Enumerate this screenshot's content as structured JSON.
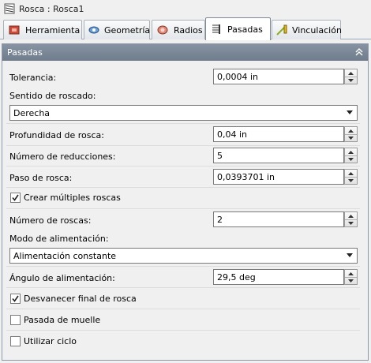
{
  "title": "Rosca : Rosca1",
  "tabs": [
    {
      "label": "Herramienta",
      "icon": "tool-icon",
      "active": false
    },
    {
      "label": "Geometría",
      "icon": "geometry-icon",
      "active": false
    },
    {
      "label": "Radios",
      "icon": "radii-icon",
      "active": false
    },
    {
      "label": "Pasadas",
      "icon": "passes-icon",
      "active": true
    },
    {
      "label": "Vinculación",
      "icon": "linking-icon",
      "active": false
    }
  ],
  "panel": {
    "title": "Pasadas",
    "tolerance": {
      "label": "Tolerancia:",
      "value": "0,0004 in"
    },
    "direction": {
      "label": "Sentido de roscado:",
      "value": "Derecha"
    },
    "depth": {
      "label": "Profundidad de rosca:",
      "value": "0,04 in"
    },
    "reductions": {
      "label": "Número de reducciones:",
      "value": "5"
    },
    "pitch": {
      "label": "Paso de rosca:",
      "value": "0,0393701 in"
    },
    "multiple": {
      "label": "Crear múltiples roscas",
      "checked": true
    },
    "thread_count": {
      "label": "Número de roscas:",
      "value": "2"
    },
    "feed_mode": {
      "label": "Modo de alimentación:",
      "value": "Alimentación constante"
    },
    "feed_angle": {
      "label": "Ángulo de alimentación:",
      "value": "29,5 deg"
    },
    "fade": {
      "label": "Desvanecer final de rosca",
      "checked": true
    },
    "spring": {
      "label": "Pasada de muelle",
      "checked": false
    },
    "cycle": {
      "label": "Utilizar ciclo",
      "checked": false
    }
  },
  "colors": {
    "header": "#7a8696",
    "accent_tab": "#ffffff"
  }
}
